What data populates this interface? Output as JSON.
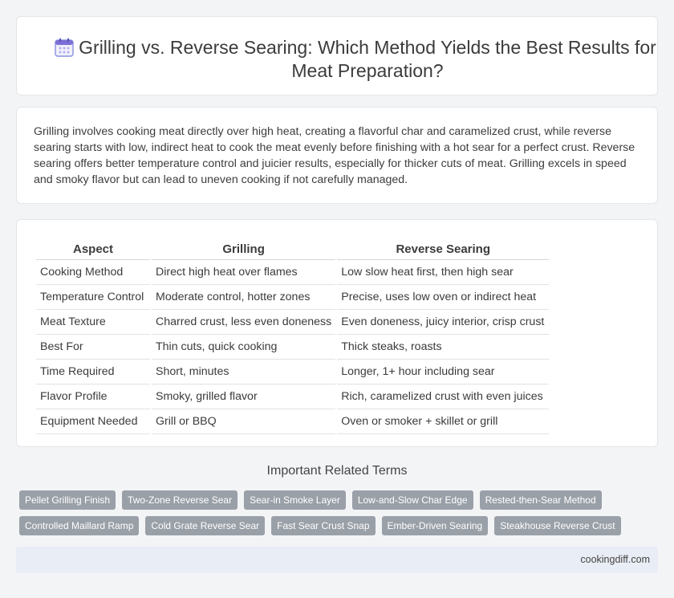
{
  "page": {
    "title": "Grilling vs. Reverse Searing: Which Method Yields the Best Results for Meat Preparation?",
    "icon": "calendar-icon",
    "accent_color": "#7c6fd6"
  },
  "summary": "Grilling involves cooking meat directly over high heat, creating a flavorful char and caramelized crust, while reverse searing starts with low, indirect heat to cook the meat evenly before finishing with a hot sear for a perfect crust. Reverse searing offers better temperature control and juicier results, especially for thicker cuts of meat. Grilling excels in speed and smoky flavor but can lead to uneven cooking if not carefully managed.",
  "table": {
    "headers": [
      "Aspect",
      "Grilling",
      "Reverse Searing"
    ],
    "rows": [
      [
        "Cooking Method",
        "Direct high heat over flames",
        "Low slow heat first, then high sear"
      ],
      [
        "Temperature Control",
        "Moderate control, hotter zones",
        "Precise, uses low oven or indirect heat"
      ],
      [
        "Meat Texture",
        "Charred crust, less even doneness",
        "Even doneness, juicy interior, crisp crust"
      ],
      [
        "Best For",
        "Thin cuts, quick cooking",
        "Thick steaks, roasts"
      ],
      [
        "Time Required",
        "Short, minutes",
        "Longer, 1+ hour including sear"
      ],
      [
        "Flavor Profile",
        "Smoky, grilled flavor",
        "Rich, caramelized crust with even juices"
      ],
      [
        "Equipment Needed",
        "Grill or BBQ",
        "Oven or smoker + skillet or grill"
      ]
    ]
  },
  "related": {
    "title": "Important Related Terms",
    "rows": [
      [
        "Pellet Grilling Finish",
        "Two-Zone Reverse Sear",
        "Sear-in Smoke Layer",
        "Low-and-Slow Char Edge",
        "Rested-then-Sear Method"
      ],
      [
        "Controlled Maillard Ramp",
        "Cold Grate Reverse Sear",
        "Fast Sear Crust Snap",
        "Ember-Driven Searing",
        "Steakhouse Reverse Crust"
      ]
    ]
  },
  "footer": {
    "site": "cookingdiff.com"
  }
}
